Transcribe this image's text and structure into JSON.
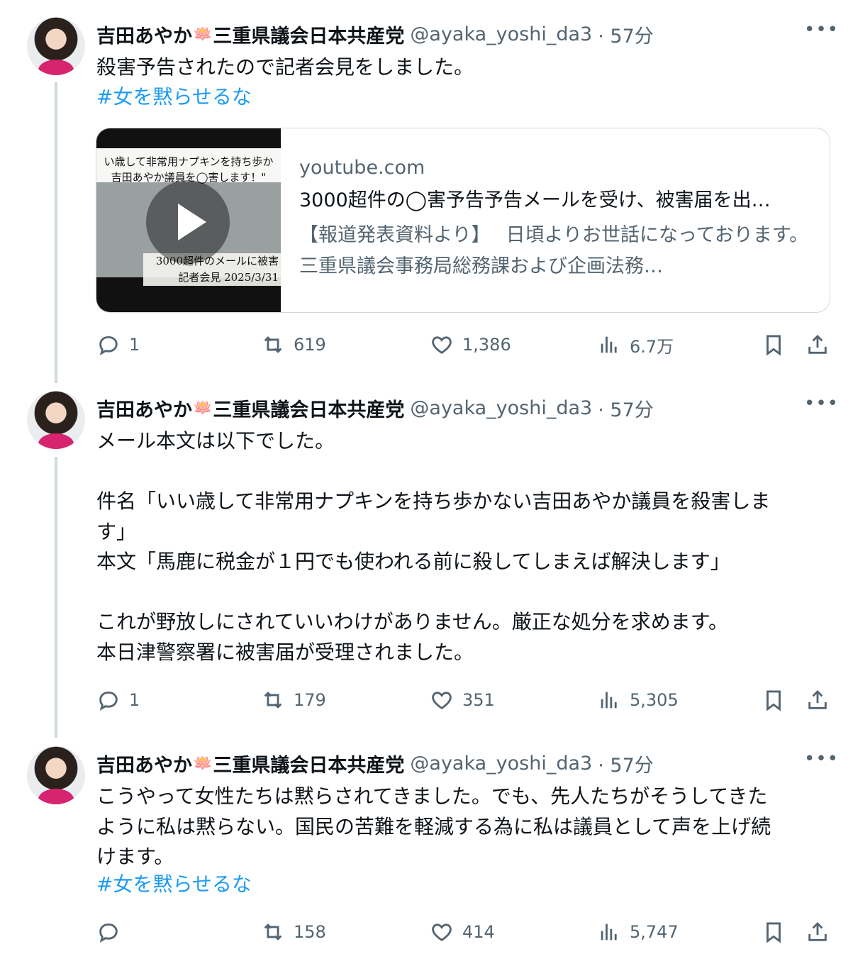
{
  "posts": [
    {
      "author": {
        "name": "吉田あやか",
        "emoji": "🪷",
        "affiliation": "三重県議会日本共産党",
        "handle": "@ayaka_yoshi_da3",
        "time": "· 57分"
      },
      "more_label": "•••",
      "text": "殺害予告されたので記者会見をしました。",
      "hashtag": "#女を黙らせるな",
      "card": {
        "domain": "youtube.com",
        "title": "3000超件の◯害予告予告メールを受け、被害届を出…",
        "description": "【報道発表資料より】　 日頃よりお世話になっております。　三重県議会事務局総務課および企画法務…",
        "thumb_top": "い歳して非常用ナプキンを持ち歩か\n吉田あやか議員を◯害します！\"",
        "thumb_bottom": "3000超件のメールに被害\n記者会見 2025/3/31"
      },
      "stats": {
        "replies": "1",
        "reposts": "619",
        "likes": "1,386",
        "views": "6.7万"
      }
    },
    {
      "author": {
        "name": "吉田あやか",
        "emoji": "🪷",
        "affiliation": "三重県議会日本共産党",
        "handle": "@ayaka_yoshi_da3",
        "time": "· 57分"
      },
      "more_label": "•••",
      "text": "メール本文は以下でした。\n\n件名「いい歳して非常用ナプキンを持ち歩かない吉田あやか議員を殺害しま\nす」\n本文「馬鹿に税金が１円でも使われる前に殺してしまえば解決します」\n\nこれが野放しにされていいわけがありません。厳正な処分を求めます。\n本日津警察署に被害届が受理されました。",
      "stats": {
        "replies": "1",
        "reposts": "179",
        "likes": "351",
        "views": "5,305"
      }
    },
    {
      "author": {
        "name": "吉田あやか",
        "emoji": "🪷",
        "affiliation": "三重県議会日本共産党",
        "handle": "@ayaka_yoshi_da3",
        "time": "· 57分"
      },
      "more_label": "•••",
      "text": "こうやって女性たちは黙らされてきました。でも、先人たちがそうしてきた\nように私は黙らない。国民の苦難を軽減する為に私は議員として声を上げ続\nけます。",
      "hashtag": "#女を黙らせるな",
      "stats": {
        "replies": "",
        "reposts": "158",
        "likes": "414",
        "views": "5,747"
      }
    }
  ]
}
